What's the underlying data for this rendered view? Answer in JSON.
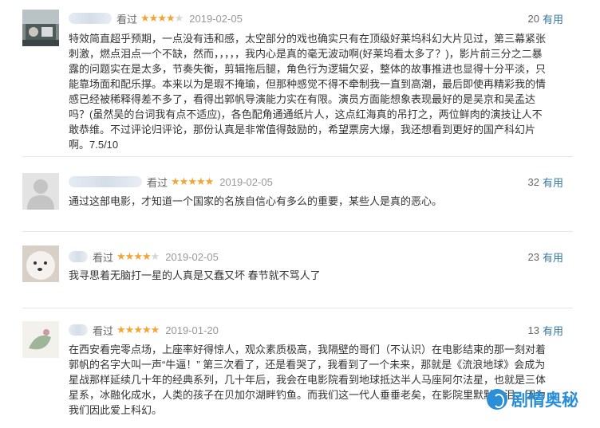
{
  "reviews": [
    {
      "status": "看过",
      "rating": 4,
      "stars_on": "★★★★",
      "stars_off": "★",
      "date": "2019-02-05",
      "votes": "20",
      "useful_label": "有用",
      "content": "特效简直超乎预期，一点没有违和感，太空部分的戏也确实只有在顶级好莱坞科幻大片见过，第三幕紧张刺激，燃点泪点一个不缺，然而，，，，，我内心是真的毫无波动啊(好莱坞看太多了？)，影片前三分之二暴露的问题实在是太多，节奏失衡，剪辑拖后腿，角色行为逻辑欠妥，整体的故事推进也显得十分平淡，只能靠场面和配乐撑。本来以为是瑕不掩瑜，但那种感觉不得不牵制我一直到高潮，最后即使再精彩我的情感已经被稀释得差不多了，看得出郭帆导演能力实在有限。演员方面能想象表现最好的是吴京和吴孟达吗？(虽然吴的台词我有点不适应)，各色配角通通纸片人，这点红海真的吊打之，两位鲜肉的演技让人不敢恭维。不过评论归评论，那份认真是非常值得鼓励的，希望票房大爆，我还想看到更好的国产科幻片啊。7.5/10"
    },
    {
      "status": "看过",
      "rating": 5,
      "stars_on": "★★★★★",
      "stars_off": "",
      "date": "2019-02-05",
      "votes": "32",
      "useful_label": "有用",
      "content": "通过这部电影，才知道一个国家的名族自信心有多么的重要，某些人是真的恶心。"
    },
    {
      "status": "看过",
      "rating": 4,
      "stars_on": "★★★★",
      "stars_off": "★",
      "date": "2019-02-05",
      "votes": "23",
      "useful_label": "有用",
      "content": "我寻思着无脑打一星的人真是又蠢又坏 春节就不骂人了"
    },
    {
      "status": "看过",
      "rating": 5,
      "stars_on": "★★★★★",
      "stars_off": "",
      "date": "2019-01-20",
      "votes": "13",
      "useful_label": "有用",
      "content": "在西安看完零点场，上座率好得惊人，观众素质极高，我隔壁的哥们（不认识）在电影结束的那一刻对着郭帆的名字大叫一声“牛逼！” 第三次看了，还是看哭了，我看到了一个未来，那就是《流浪地球》会成为星战那样延续几十年的经典系列，几十年后，我会在电影院看到地球抵达半人马座阿尔法星，也就是三体星系，冰融化成水，人类的孩子在贝加尔湖畔钓鱼。而我们这一代人垂垂老矣，在影院里默默流泪，因为我们因此爱上科幻。"
    }
  ],
  "watermark": {
    "text": "剧情奥秘",
    "color": "#2a8fd8"
  },
  "colors": {
    "star": "#f2a533",
    "link": "#3377aa"
  }
}
